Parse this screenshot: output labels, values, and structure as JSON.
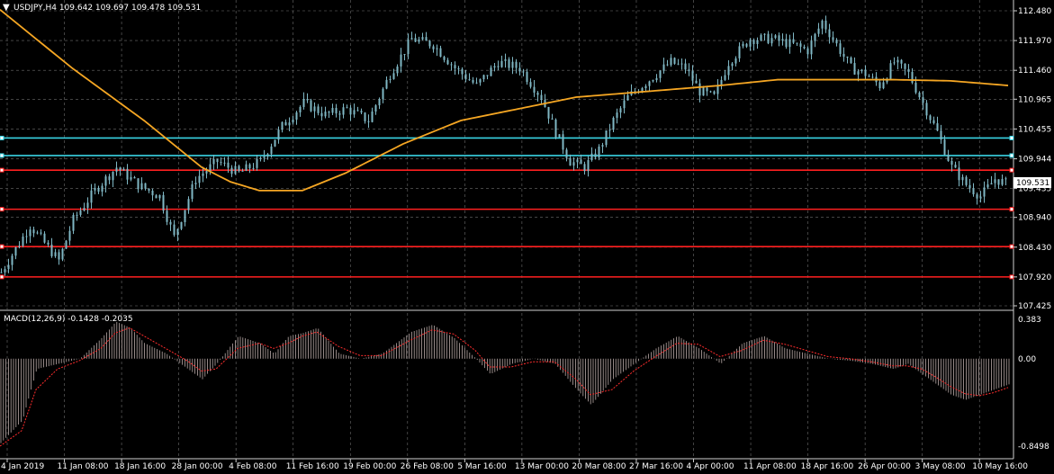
{
  "header": {
    "symbol_info": "USDJPY,H4  109.642 109.697 109.478 109.531"
  },
  "macd": {
    "label": "MACD(12,26,9) -0.1428 -0.2035"
  },
  "colors": {
    "background": "#000000",
    "grid": "#6e6e6e",
    "candle": "#7fb7c4",
    "ma": "#f5a623",
    "support_line": "#ff2020",
    "resistance_line": "#39d3e3",
    "macd_hist": "#b9a9a7",
    "macd_signal": "#ff2d2d"
  },
  "chart_data": {
    "type": "candlestick",
    "title": "USDJPY,H4",
    "price_axis": {
      "ticks": [
        "112.480",
        "111.970",
        "111.460",
        "110.965",
        "110.455",
        "109.944",
        "109.435",
        "108.940",
        "108.430",
        "107.920",
        "107.425"
      ],
      "range": [
        107.425,
        112.48
      ],
      "current_price": "109.531"
    },
    "time_axis": {
      "ticks": [
        "4 Jan 2019",
        "11 Jan 08:00",
        "18 Jan 16:00",
        "28 Jan 00:00",
        "4 Feb 08:00",
        "11 Feb 16:00",
        "19 Feb 00:00",
        "26 Feb 08:00",
        "5 Mar 16:00",
        "13 Mar 00:00",
        "20 Mar 08:00",
        "27 Mar 16:00",
        "4 Apr 00:00",
        "11 Apr 08:00",
        "18 Apr 16:00",
        "26 Apr 00:00",
        "3 May 08:00",
        "10 May 16:00"
      ]
    },
    "horizontal_levels": [
      {
        "price": 110.3,
        "color": "cyan"
      },
      {
        "price": 110.0,
        "color": "cyan"
      },
      {
        "price": 109.75,
        "color": "red"
      },
      {
        "price": 109.08,
        "color": "red"
      },
      {
        "price": 108.44,
        "color": "red"
      },
      {
        "price": 107.92,
        "color": "red"
      }
    ],
    "price_path": [
      [
        0,
        108.0
      ],
      [
        4,
        108.8
      ],
      [
        8,
        108.2
      ],
      [
        10,
        108.9
      ],
      [
        13,
        109.4
      ],
      [
        16,
        109.8
      ],
      [
        19,
        109.5
      ],
      [
        22,
        109.3
      ],
      [
        24,
        108.6
      ],
      [
        27,
        109.6
      ],
      [
        30,
        109.9
      ],
      [
        33,
        109.7
      ],
      [
        36,
        109.9
      ],
      [
        39,
        110.5
      ],
      [
        42,
        110.9
      ],
      [
        45,
        110.7
      ],
      [
        48,
        110.8
      ],
      [
        51,
        110.6
      ],
      [
        54,
        111.4
      ],
      [
        57,
        112.0
      ],
      [
        60,
        111.9
      ],
      [
        63,
        111.5
      ],
      [
        66,
        111.2
      ],
      [
        69,
        111.6
      ],
      [
        72,
        111.5
      ],
      [
        75,
        111.0
      ],
      [
        77,
        110.4
      ],
      [
        79,
        109.9
      ],
      [
        81,
        109.8
      ],
      [
        83,
        110.1
      ],
      [
        85,
        110.6
      ],
      [
        87,
        111.0
      ],
      [
        90,
        111.3
      ],
      [
        93,
        111.6
      ],
      [
        95,
        111.5
      ],
      [
        97,
        111.1
      ],
      [
        99,
        111.0
      ],
      [
        101,
        111.6
      ],
      [
        104,
        112.0
      ],
      [
        107,
        112.0
      ],
      [
        110,
        111.9
      ],
      [
        112,
        111.8
      ],
      [
        114,
        112.3
      ],
      [
        116,
        111.9
      ],
      [
        118,
        111.5
      ],
      [
        120,
        111.4
      ],
      [
        122,
        111.2
      ],
      [
        124,
        111.6
      ],
      [
        126,
        111.4
      ],
      [
        128,
        110.9
      ],
      [
        130,
        110.4
      ],
      [
        132,
        109.8
      ],
      [
        134,
        109.5
      ],
      [
        136,
        109.3
      ],
      [
        138,
        109.6
      ],
      [
        140,
        109.5
      ]
    ],
    "ma_path": [
      [
        0,
        112.5
      ],
      [
        10,
        111.5
      ],
      [
        20,
        110.6
      ],
      [
        28,
        109.8
      ],
      [
        32,
        109.55
      ],
      [
        36,
        109.4
      ],
      [
        42,
        109.4
      ],
      [
        48,
        109.7
      ],
      [
        56,
        110.2
      ],
      [
        64,
        110.6
      ],
      [
        72,
        110.8
      ],
      [
        80,
        111.0
      ],
      [
        90,
        111.1
      ],
      [
        100,
        111.2
      ],
      [
        108,
        111.3
      ],
      [
        116,
        111.3
      ],
      [
        124,
        111.3
      ],
      [
        132,
        111.28
      ],
      [
        140,
        111.2
      ]
    ],
    "macd_axis": {
      "ticks": [
        "0.383",
        "0.00",
        "-0.8498"
      ],
      "range": [
        -0.8498,
        0.383
      ]
    },
    "macd_path": [
      [
        0,
        -0.82
      ],
      [
        3,
        -0.6
      ],
      [
        5,
        -0.1
      ],
      [
        8,
        -0.05
      ],
      [
        11,
        0.0
      ],
      [
        14,
        0.2
      ],
      [
        16,
        0.36
      ],
      [
        18,
        0.3
      ],
      [
        20,
        0.15
      ],
      [
        23,
        0.05
      ],
      [
        26,
        -0.1
      ],
      [
        28,
        -0.2
      ],
      [
        30,
        -0.05
      ],
      [
        33,
        0.22
      ],
      [
        36,
        0.15
      ],
      [
        38,
        0.05
      ],
      [
        40,
        0.22
      ],
      [
        42,
        0.25
      ],
      [
        44,
        0.3
      ],
      [
        47,
        0.05
      ],
      [
        50,
        0.0
      ],
      [
        53,
        0.05
      ],
      [
        57,
        0.26
      ],
      [
        60,
        0.33
      ],
      [
        63,
        0.2
      ],
      [
        66,
        0.0
      ],
      [
        68,
        -0.15
      ],
      [
        71,
        -0.05
      ],
      [
        74,
        0.0
      ],
      [
        77,
        -0.05
      ],
      [
        80,
        -0.3
      ],
      [
        82,
        -0.45
      ],
      [
        85,
        -0.2
      ],
      [
        88,
        -0.05
      ],
      [
        91,
        0.1
      ],
      [
        94,
        0.22
      ],
      [
        97,
        0.1
      ],
      [
        100,
        -0.05
      ],
      [
        103,
        0.15
      ],
      [
        106,
        0.22
      ],
      [
        109,
        0.1
      ],
      [
        112,
        0.05
      ],
      [
        115,
        0.0
      ],
      [
        118,
        -0.02
      ],
      [
        121,
        -0.05
      ],
      [
        124,
        -0.1
      ],
      [
        126,
        -0.05
      ],
      [
        128,
        -0.15
      ],
      [
        130,
        -0.25
      ],
      [
        132,
        -0.35
      ],
      [
        134,
        -0.4
      ],
      [
        136,
        -0.35
      ],
      [
        138,
        -0.3
      ],
      [
        140,
        -0.25
      ]
    ],
    "signal_path": [
      [
        0,
        -0.85
      ],
      [
        3,
        -0.7
      ],
      [
        5,
        -0.3
      ],
      [
        8,
        -0.1
      ],
      [
        11,
        -0.02
      ],
      [
        14,
        0.1
      ],
      [
        16,
        0.25
      ],
      [
        18,
        0.3
      ],
      [
        20,
        0.22
      ],
      [
        23,
        0.1
      ],
      [
        26,
        -0.02
      ],
      [
        28,
        -0.12
      ],
      [
        30,
        -0.1
      ],
      [
        33,
        0.1
      ],
      [
        36,
        0.15
      ],
      [
        38,
        0.1
      ],
      [
        40,
        0.15
      ],
      [
        42,
        0.22
      ],
      [
        44,
        0.26
      ],
      [
        47,
        0.12
      ],
      [
        50,
        0.03
      ],
      [
        53,
        0.03
      ],
      [
        57,
        0.18
      ],
      [
        60,
        0.28
      ],
      [
        63,
        0.24
      ],
      [
        66,
        0.08
      ],
      [
        68,
        -0.08
      ],
      [
        71,
        -0.08
      ],
      [
        74,
        -0.03
      ],
      [
        77,
        -0.03
      ],
      [
        80,
        -0.2
      ],
      [
        82,
        -0.35
      ],
      [
        85,
        -0.3
      ],
      [
        88,
        -0.12
      ],
      [
        91,
        0.02
      ],
      [
        94,
        0.15
      ],
      [
        97,
        0.14
      ],
      [
        100,
        0.02
      ],
      [
        103,
        0.08
      ],
      [
        106,
        0.18
      ],
      [
        109,
        0.14
      ],
      [
        112,
        0.08
      ],
      [
        115,
        0.02
      ],
      [
        118,
        0.0
      ],
      [
        121,
        -0.03
      ],
      [
        124,
        -0.07
      ],
      [
        126,
        -0.07
      ],
      [
        128,
        -0.1
      ],
      [
        130,
        -0.18
      ],
      [
        132,
        -0.27
      ],
      [
        134,
        -0.34
      ],
      [
        136,
        -0.36
      ],
      [
        138,
        -0.33
      ],
      [
        140,
        -0.28
      ]
    ]
  }
}
